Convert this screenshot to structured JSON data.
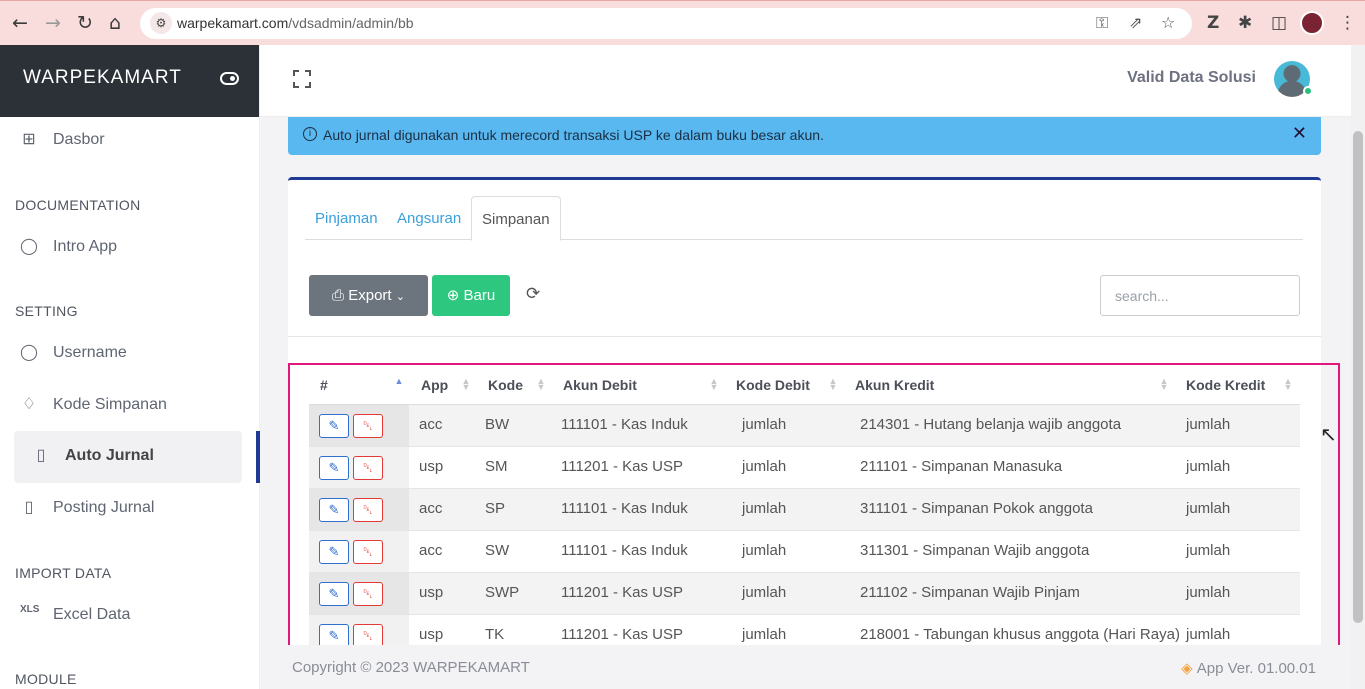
{
  "browser": {
    "url_host": "warpekamart.com",
    "url_path": "/vdsadmin/admin/bb"
  },
  "sidebar": {
    "brand": "WARPEKAMART",
    "items": [
      {
        "label": "Dasbor",
        "icon": "dashboard-icon"
      },
      {
        "label": "Intro App",
        "icon": "user-icon"
      },
      {
        "label": "Username",
        "icon": "user-icon"
      },
      {
        "label": "Kode Simpanan",
        "icon": "tag-icon"
      },
      {
        "label": "Auto Jurnal",
        "icon": "file-icon"
      },
      {
        "label": "Posting Jurnal",
        "icon": "file-icon"
      },
      {
        "label": "Excel Data",
        "icon": "excel-icon"
      }
    ],
    "sections": [
      "DOCUMENTATION",
      "SETTING",
      "IMPORT DATA",
      "MODULE"
    ]
  },
  "header": {
    "user_name": "Valid Data Solusi"
  },
  "alert": {
    "text": "Auto jurnal digunakan untuk merecord transaksi USP ke dalam buku besar akun."
  },
  "tabs": [
    "Pinjaman",
    "Angsuran",
    "Simpanan"
  ],
  "active_tab": "Simpanan",
  "toolbar": {
    "export_label": "Export",
    "new_label": "Baru",
    "search_placeholder": "search..."
  },
  "table": {
    "columns": [
      "#",
      "App",
      "Kode",
      "Akun Debit",
      "Kode Debit",
      "Akun Kredit",
      "Kode Kredit"
    ],
    "rows": [
      [
        "acc",
        "BW",
        "111101 - Kas Induk",
        "jumlah",
        "214301 - Hutang belanja wajib anggota",
        "jumlah"
      ],
      [
        "usp",
        "SM",
        "111201 - Kas USP",
        "jumlah",
        "211101 - Simpanan Manasuka",
        "jumlah"
      ],
      [
        "acc",
        "SP",
        "111101 - Kas Induk",
        "jumlah",
        "311101 - Simpanan Pokok anggota",
        "jumlah"
      ],
      [
        "acc",
        "SW",
        "111101 - Kas Induk",
        "jumlah",
        "311301 - Simpanan Wajib anggota",
        "jumlah"
      ],
      [
        "usp",
        "SWP",
        "111201 - Kas USP",
        "jumlah",
        "211102 - Simpanan Wajib Pinjam",
        "jumlah"
      ],
      [
        "usp",
        "TK",
        "111201 - Kas USP",
        "jumlah",
        "218001 - Tabungan khusus anggota (Hari Raya)",
        "jumlah"
      ]
    ]
  },
  "footer": {
    "copyright": "Copyright © 2023 WARPEKAMART",
    "version": "App Ver. 01.00.01"
  },
  "colors": {
    "sidebar_brand_bg": "#2b3137",
    "accent": "#1f3a93",
    "alert_bg": "#5ab8f0",
    "btn_baru": "#2dc77f",
    "btn_export": "#6c757d",
    "highlight": "#e0177c"
  }
}
